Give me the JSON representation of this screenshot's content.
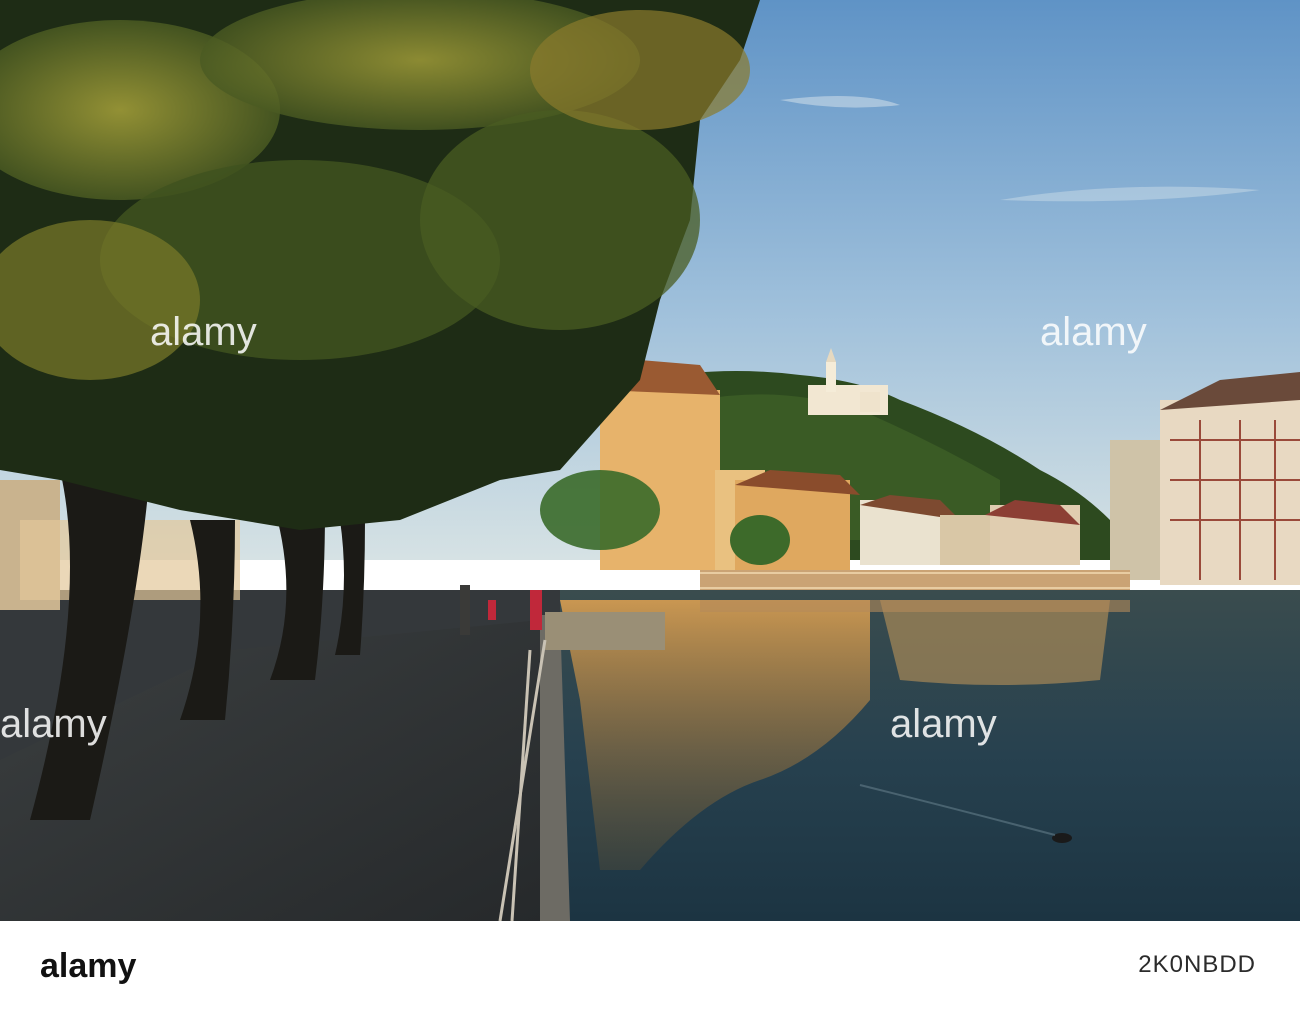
{
  "image": {
    "alt": "Riverside promenade with chestnut trees, old town buildings, a hilltop castle and a footbridge reflected in the river at golden hour",
    "palette": {
      "sky_top": "#6f9fcd",
      "sky_bottom": "#c7d9e4",
      "foliage_dark": "#1f2d16",
      "foliage_lit": "#8c8a2b",
      "facade_gold": "#e8b872",
      "water": "#2a3f4a",
      "reflection_gold": "#c98f3e",
      "walkway": "#2d3236"
    }
  },
  "watermark": {
    "text": "alamy",
    "color": "#ffffff"
  },
  "footer": {
    "logo_text": "alamy",
    "image_id": "2K0NBDD"
  }
}
